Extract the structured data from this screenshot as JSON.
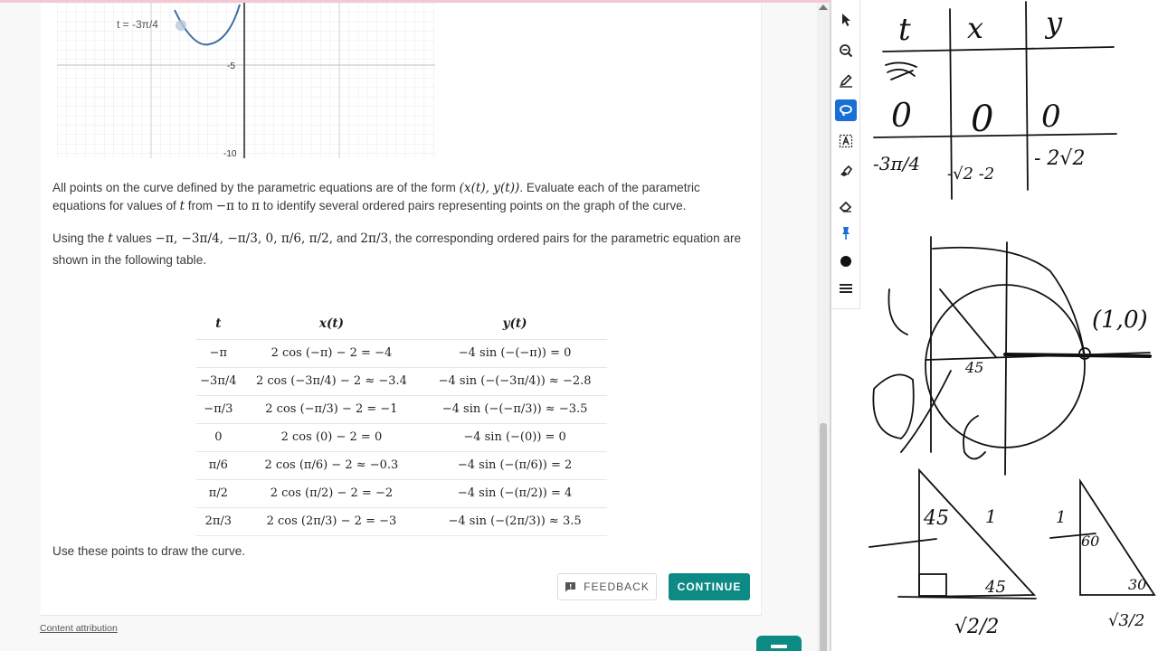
{
  "graph": {
    "t_label": "t = -3π/4",
    "y_tick_5": "-5",
    "y_tick_10": "-10"
  },
  "paragraph1": {
    "a": "All points on the curve defined by the parametric equations are of the form ",
    "b": "(x(t), y(t))",
    "c": ". Evaluate each of the parametric equations for values of ",
    "d": "t",
    "e": " from ",
    "f": "−π",
    "g": " to ",
    "h": "π",
    "i": " to identify several ordered pairs representing points on the graph of the curve."
  },
  "paragraph2": {
    "a": "Using the ",
    "b": "t",
    "c": " values ",
    "d": "−π, −3π/4, −π/3, 0, π/6, π/2,",
    "e": " and ",
    "f": "2π/3",
    "g": ", the corresponding ordered pairs for the parametric equation are shown in the following table."
  },
  "table": {
    "headers": [
      "t",
      "x(t)",
      "y(t)"
    ],
    "rows": [
      [
        "−π",
        "2 cos (−π) − 2 = −4",
        "−4 sin (−(−π)) = 0"
      ],
      [
        "−3π/4",
        "2 cos (−3π/4) − 2 ≈ −3.4",
        "−4 sin (−(−3π/4)) ≈ −2.8"
      ],
      [
        "−π/3",
        "2 cos (−π/3) − 2 = −1",
        "−4 sin (−(−π/3)) ≈ −3.5"
      ],
      [
        "0",
        "2 cos (0) − 2 = 0",
        "−4 sin (−(0)) = 0"
      ],
      [
        "π/6",
        "2 cos (π/6) − 2 ≈ −0.3",
        "−4 sin (−(π/6)) = 2"
      ],
      [
        "π/2",
        "2 cos (π/2) − 2 = −2",
        "−4 sin (−(π/2)) = 4"
      ],
      [
        "2π/3",
        "2 cos (2π/3) − 2 = −3",
        "−4 sin (−(2π/3)) ≈ 3.5"
      ]
    ]
  },
  "paragraph3": "Use these points to draw the curve.",
  "buttons": {
    "feedback": "FEEDBACK",
    "continue": "CONTINUE"
  },
  "attribution": "Content attribution",
  "toolbar": {
    "tools": [
      "pointer-icon",
      "zoom-icon",
      "pen-icon",
      "lasso-icon",
      "text-box-icon",
      "highlighter-icon",
      "eraser-icon",
      "pin-icon",
      "color-dot-icon",
      "menu-icon"
    ],
    "active_tool": "lasso-icon",
    "accent": "#1a6fd6"
  },
  "colors": {
    "primary": "#0e8a85",
    "curve": "#3a6e9e"
  },
  "whiteboard": {
    "header_t": "t",
    "header_x": "x",
    "header_y": "y",
    "row1": [
      "0",
      "0",
      "0"
    ],
    "row2": [
      "-3π/4",
      "-√2 -2",
      "- 2√2"
    ],
    "label_1_0": "(1,0)",
    "label_45": "45",
    "label_1": "1",
    "label_60": "60",
    "label_30": "30",
    "label_sqrt3_2": "√3/2",
    "label_sqrt2_2": "√2/2"
  }
}
